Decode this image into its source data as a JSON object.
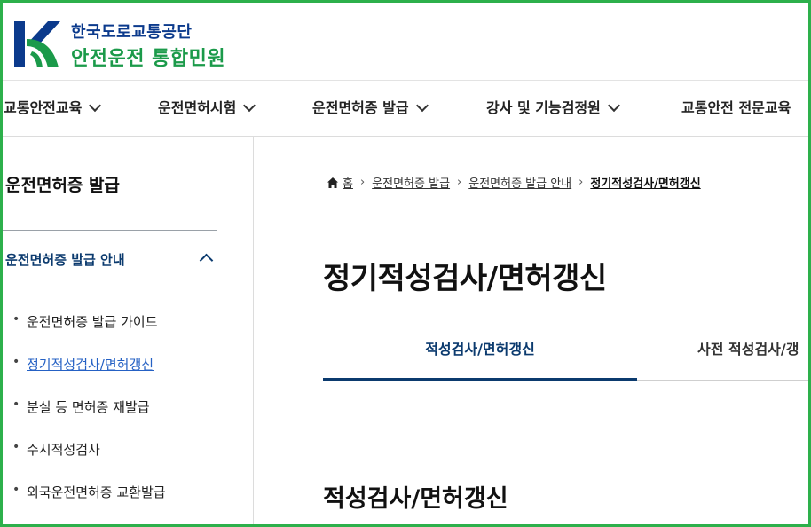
{
  "header": {
    "org_name": "한국도로교통공단",
    "site_name": "안전운전 통합민원"
  },
  "gnb": {
    "items": [
      {
        "label": "교통안전교육"
      },
      {
        "label": "운전면허시험"
      },
      {
        "label": "운전면허증 발급"
      },
      {
        "label": "강사 및 기능검정원"
      },
      {
        "label": "교통안전 전문교육"
      }
    ]
  },
  "sidebar": {
    "title": "운전면허증 발급",
    "group_label": "운전면허증 발급 안내",
    "items": [
      {
        "label": "운전면허증 발급 가이드"
      },
      {
        "label": "정기적성검사/면허갱신"
      },
      {
        "label": "분실 등 면허증 재발급"
      },
      {
        "label": "수시적성검사"
      },
      {
        "label": "외국운전면허증 교환발급"
      }
    ]
  },
  "breadcrumb": {
    "home": "홈",
    "level1": "운전면허증 발급",
    "level2": "운전면허증 발급 안내",
    "current": "정기적성검사/면허갱신"
  },
  "main": {
    "title": "정기적성검사/면허갱신",
    "tabs": [
      {
        "label": "적성검사/면허갱신"
      },
      {
        "label": "사전 적성검사/갱"
      }
    ],
    "section_title": "적성검사/면허갱신"
  },
  "colors": {
    "brand_blue": "#0b3a8c",
    "brand_green": "#1b9a4a",
    "active_link": "#2561c4",
    "frame_border": "#2db04b"
  },
  "icons": {
    "logo": "k-logo-icon",
    "home": "home-icon",
    "dropdown": "chevron-down-icon",
    "collapse": "chevron-up-icon"
  }
}
